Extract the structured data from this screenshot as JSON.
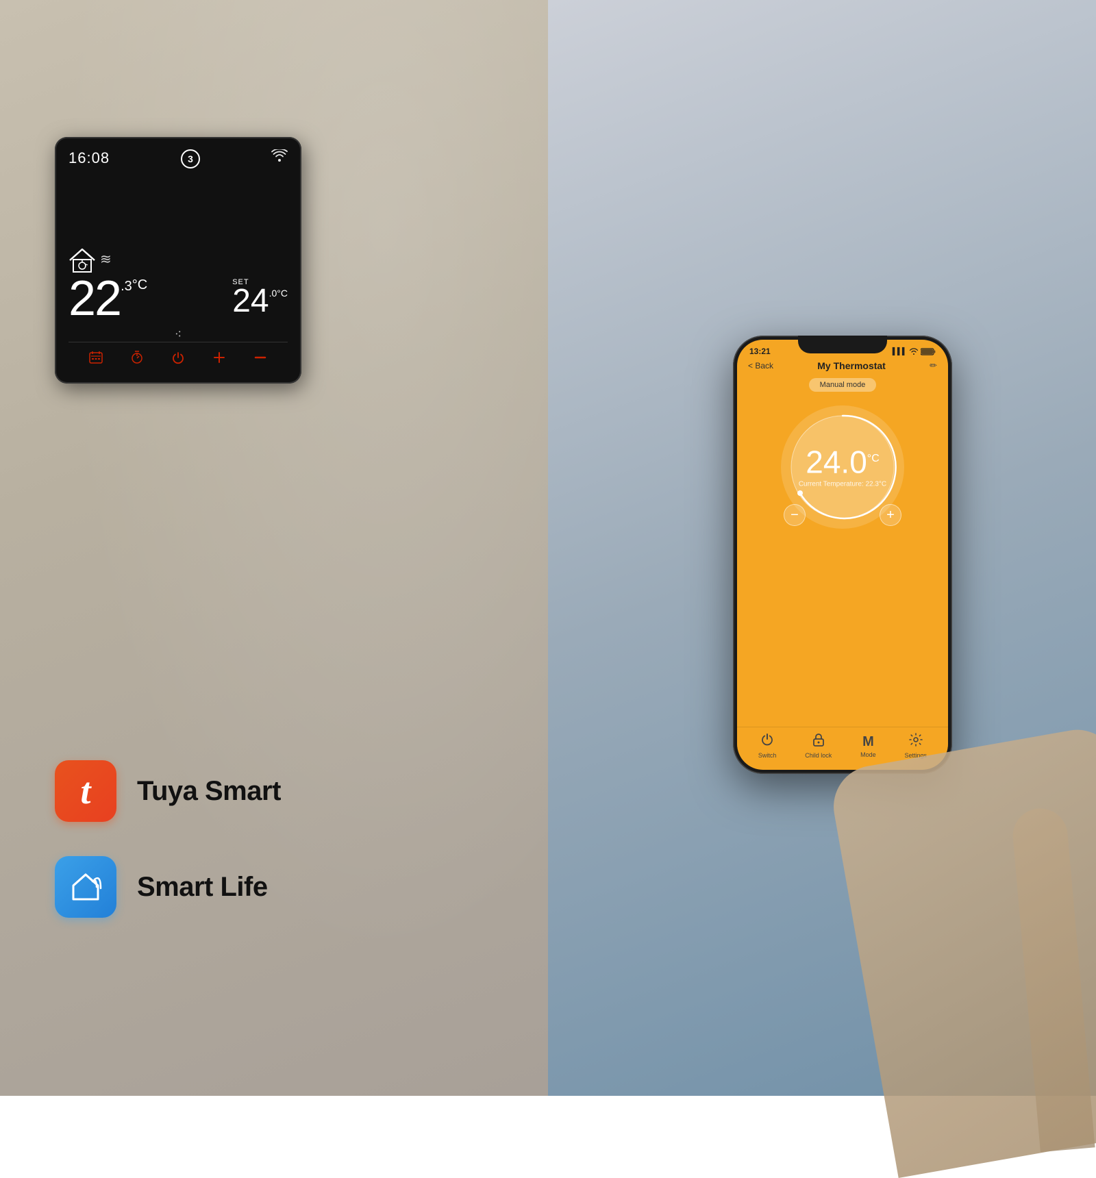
{
  "left": {
    "thermostat": {
      "time": "16:08",
      "program_number": "3",
      "current_temp": "22",
      "current_decimal": ".3",
      "current_unit": "°C",
      "set_label": "SET",
      "set_temp": "24",
      "set_decimal": ".0",
      "set_unit": "°C"
    },
    "brands": [
      {
        "id": "tuya",
        "logo_letter": "t",
        "name": "Tuya Smart"
      },
      {
        "id": "smart-life",
        "name": "Smart Life"
      }
    ]
  },
  "right": {
    "phone": {
      "status_bar": {
        "time": "13:21",
        "signal": "▌▌▌",
        "wifi": "WiFi",
        "battery": "🔋"
      },
      "header": {
        "back_label": "< Back",
        "title": "My Thermostat",
        "edit_icon": "✏"
      },
      "mode_badge": "Manual mode",
      "dial": {
        "set_temp": "24.0",
        "set_unit": "°C",
        "current_label": "Current Temperature: 22.3°C",
        "minus_label": "−",
        "plus_label": "+"
      },
      "nav_items": [
        {
          "id": "switch",
          "icon": "⏻",
          "label": "Switch"
        },
        {
          "id": "child-lock",
          "icon": "🔓",
          "label": "Child lock"
        },
        {
          "id": "mode",
          "icon": "M",
          "label": "Mode"
        },
        {
          "id": "settings",
          "icon": "⚙",
          "label": "Settings"
        }
      ]
    }
  }
}
